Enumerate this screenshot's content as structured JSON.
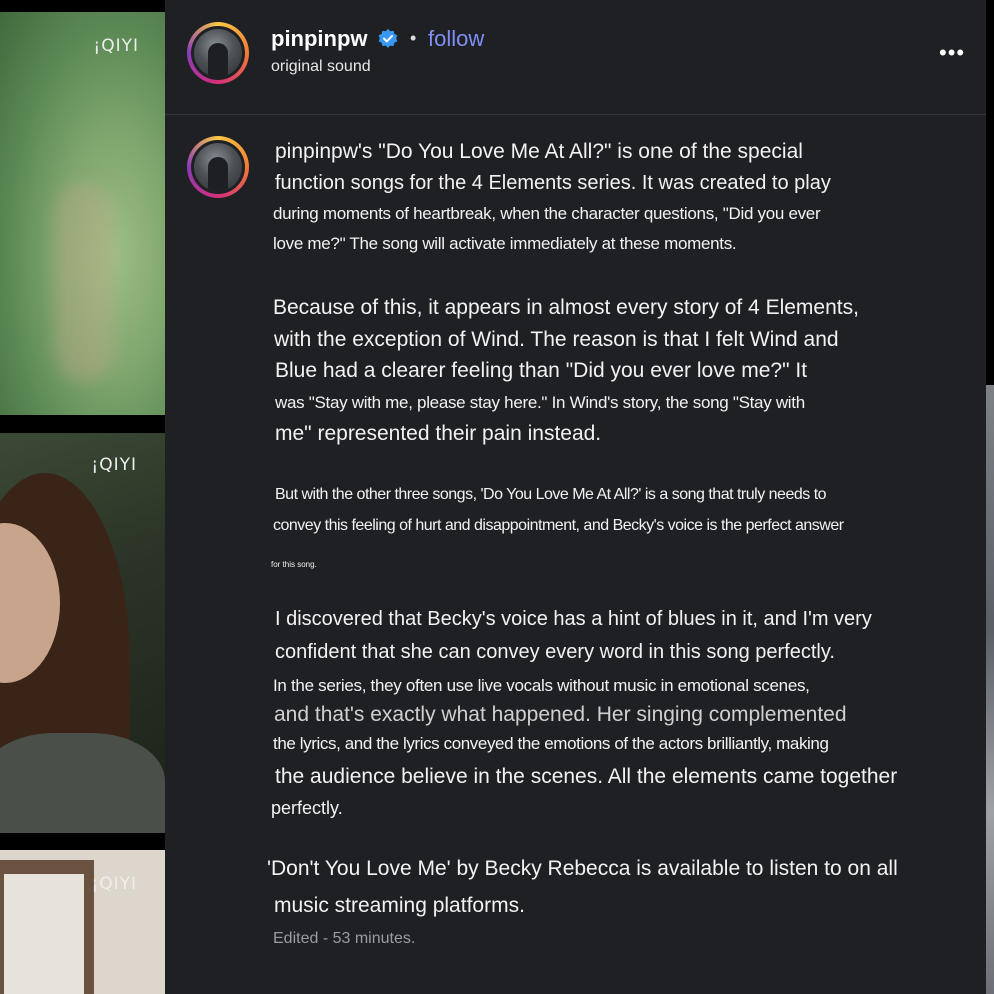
{
  "thumbnails": [
    {
      "watermark": "¡QIYI"
    },
    {
      "watermark": "¡QIYI"
    },
    {
      "watermark": "¡QIYI"
    }
  ],
  "post": {
    "username": "pinpinpw",
    "follow_label": "follow",
    "separator": "•",
    "audio": "original sound",
    "more_label": "•••",
    "caption_lines": [
      "pinpinpw's \"Do You Love Me At All?\" is one of the special",
      "function songs for the 4 Elements series. It was created to play",
      "during moments of heartbreak, when the character questions, \"Did you ever",
      "love me?\" The song will activate immediately at these moments.",
      "Because of this, it appears in almost every story of 4 Elements,",
      "with the exception of Wind. The reason is that I felt Wind and",
      "Blue had a clearer feeling than \"Did you ever love me?\" It",
      "was \"Stay with me, please stay here.\" In Wind's story, the song \"Stay with",
      "me\" represented their pain instead.",
      "But with the other three songs, 'Do You Love Me At All?' is a song that truly needs to",
      "convey this feeling of hurt and disappointment, and Becky's voice is the perfect answer",
      "for this song.",
      "I discovered that Becky's voice has a hint of blues in it, and I'm very",
      "confident that she can convey every word in this song perfectly.",
      "In the series, they often use live vocals without music in emotional scenes,",
      "and that's exactly what happened. Her singing complemented",
      "the lyrics, and the lyrics conveyed the emotions of the actors brilliantly, making",
      "the audience believe in the scenes. All the elements came together",
      "perfectly.",
      "'Don't You Love Me' by Becky Rebecca is available to listen to on all",
      "music streaming platforms."
    ],
    "edited": "Edited - 53 minutes."
  },
  "icons": {
    "verified": "verified-badge-icon",
    "more": "more-options-icon"
  },
  "colors": {
    "panel_bg": "#1f2024",
    "follow": "#7f8ff7",
    "verified": "#3897f0",
    "muted": "#9a9ca2"
  }
}
